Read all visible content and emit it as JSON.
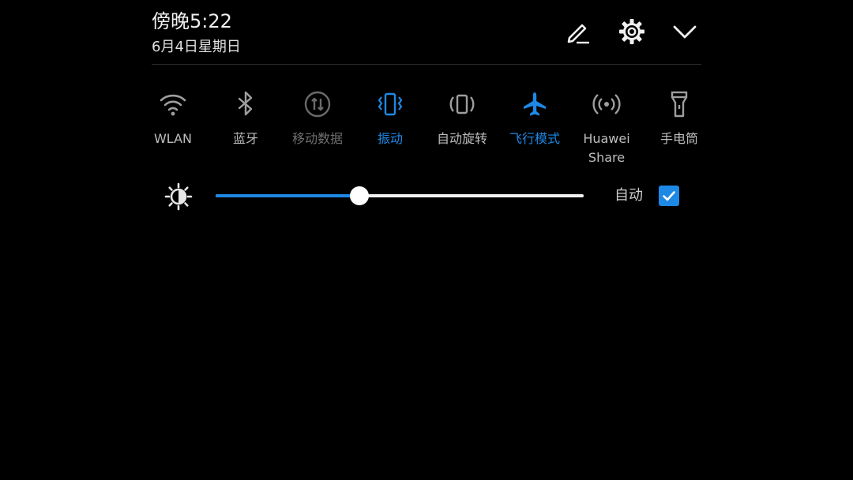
{
  "header": {
    "time": "傍晚5:22",
    "date": "6月4日星期日",
    "edit_icon": "pencil-icon",
    "settings_icon": "gear-icon",
    "collapse_icon": "chevron-down-icon"
  },
  "tiles": [
    {
      "label": "WLAN",
      "icon": "wifi-icon",
      "state": "off"
    },
    {
      "label": "蓝牙",
      "icon": "bluetooth-icon",
      "state": "off"
    },
    {
      "label": "移动数据",
      "icon": "mobile-data-icon",
      "state": "disabled"
    },
    {
      "label": "振动",
      "icon": "vibrate-icon",
      "state": "on"
    },
    {
      "label": "自动旋转",
      "icon": "auto-rotate-icon",
      "state": "off"
    },
    {
      "label": "飞行模式",
      "icon": "airplane-icon",
      "state": "on"
    },
    {
      "label": "Huawei\nShare",
      "icon": "huawei-share-icon",
      "state": "off"
    },
    {
      "label": "手电筒",
      "icon": "flashlight-icon",
      "state": "off"
    }
  ],
  "brightness": {
    "icon": "brightness-icon",
    "level": 0.39,
    "auto_label": "自动",
    "auto_checked": true
  },
  "colors": {
    "accent": "#1e88e5",
    "inactive": "#bdbdbd",
    "disabled": "#707070",
    "background": "#000000"
  }
}
